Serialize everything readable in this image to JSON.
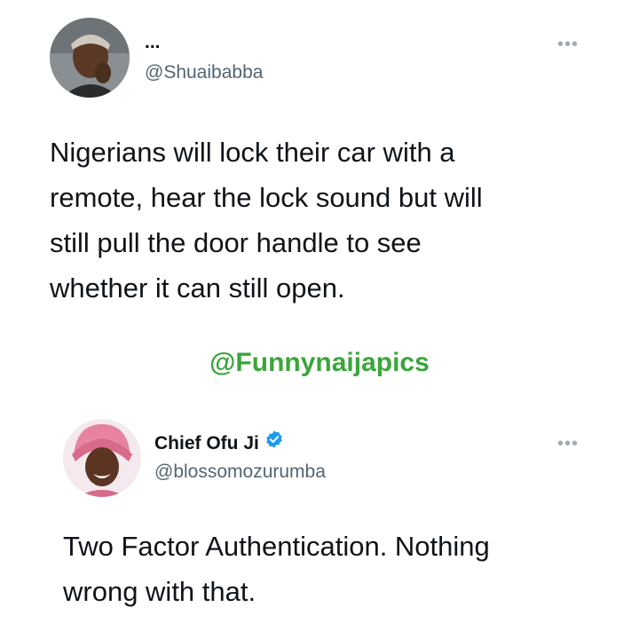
{
  "tweet1": {
    "name": "...",
    "handle": "@Shuaibabba",
    "more": "•••",
    "text": "Nigerians will lock their car with a\nremote, hear the lock sound but will\nstill pull the door handle to see\nwhether it can still open."
  },
  "watermark": "@Funnynaijapics",
  "tweet2": {
    "name": "Chief Ofu Ji",
    "verified_icon": "verified-badge-icon",
    "handle": "@blossomozurumba",
    "more": "•••",
    "text": "Two Factor Authentication. Nothing\nwrong with that."
  },
  "colors": {
    "watermark_green": "#3aa63a",
    "verified_blue": "#1d9bf0",
    "handle_gray": "#536471"
  }
}
